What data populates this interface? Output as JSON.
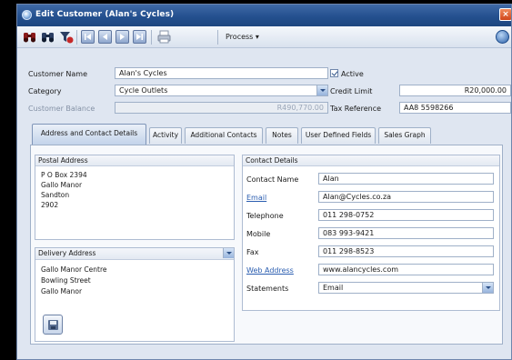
{
  "window": {
    "title": "Edit Customer (Alan's Cycles)",
    "close_label": "×"
  },
  "toolbar": {
    "buttons": [
      "binoculars-icon",
      "binoculars-next-icon",
      "filter-icon",
      "first-record-icon",
      "previous-record-icon",
      "next-record-icon",
      "last-record-icon",
      "print-icon"
    ],
    "process_label": "Process ▾"
  },
  "form": {
    "customer_name_label": "Customer Name",
    "customer_name_value": "Alan's Cycles",
    "active_label": "Active",
    "active_checked": true,
    "category_label": "Category",
    "category_value": "Cycle Outlets",
    "credit_limit_label": "Credit Limit",
    "credit_limit_value": "R20,000.00",
    "customer_balance_label": "Customer Balance",
    "customer_balance_value": "R490,770.00",
    "tax_reference_label": "Tax Reference",
    "tax_reference_value": "AA8 5598266"
  },
  "tabs": [
    {
      "label": "Address and Contact Details",
      "active": true
    },
    {
      "label": "Activity",
      "active": false
    },
    {
      "label": "Additional Contacts",
      "active": false
    },
    {
      "label": "Notes",
      "active": false
    },
    {
      "label": "User Defined Fields",
      "active": false
    },
    {
      "label": "Sales Graph",
      "active": false
    }
  ],
  "postal": {
    "header": "Postal Address",
    "lines": [
      "P O Box 2394",
      "Gallo Manor",
      "Sandton",
      "2902"
    ]
  },
  "delivery": {
    "header": "Delivery Address",
    "lines": [
      "Gallo Manor Centre",
      "Bowling Street",
      "Gallo Manor"
    ]
  },
  "contact": {
    "header": "Contact Details",
    "contact_name_label": "Contact Name",
    "contact_name_value": "Alan",
    "email_label": "Email",
    "email_value": "Alan@Cycles.co.za",
    "telephone_label": "Telephone",
    "telephone_value": "011 298-0752",
    "mobile_label": "Mobile",
    "mobile_value": "083 993-9421",
    "fax_label": "Fax",
    "fax_value": "011 298-8523",
    "web_label": "Web Address",
    "web_value": "www.alancycles.com",
    "statements_label": "Statements",
    "statements_value": "Email"
  }
}
